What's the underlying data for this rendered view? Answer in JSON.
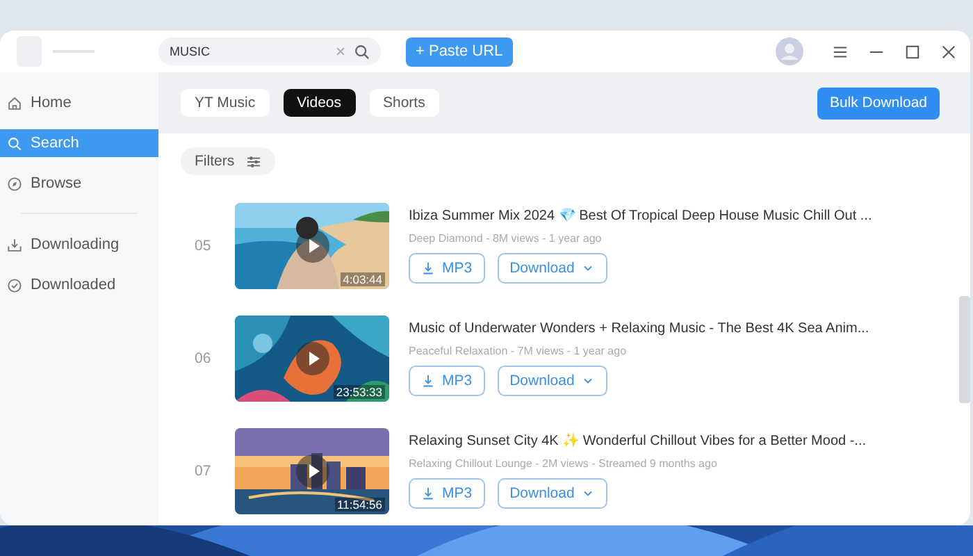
{
  "titlebar": {
    "search": {
      "value": "MUSIC"
    },
    "paste_button": "+ Paste URL"
  },
  "sidebar": {
    "groups": [
      {
        "items": [
          {
            "label": "Home",
            "selected": false
          },
          {
            "label": "Search",
            "selected": true
          },
          {
            "label": "Browse",
            "selected": false
          }
        ]
      },
      {
        "items": [
          {
            "label": "Downloading",
            "selected": false
          },
          {
            "label": "Downloaded",
            "selected": false
          }
        ]
      }
    ]
  },
  "tabs": [
    {
      "label": "YT Music",
      "selected": false
    },
    {
      "label": "Videos",
      "selected": true
    },
    {
      "label": "Shorts",
      "selected": false
    }
  ],
  "bulk_button": "Bulk Download",
  "filters": "Filters",
  "results": [
    {
      "index": "05",
      "title": "Ibiza Summer Mix 2024 💎 Best Of Tropical Deep House Music Chill Out ...",
      "meta": "Deep Diamond - 8M views - 1 year ago",
      "duration": "4:03:44",
      "mp3": "MP3",
      "download": "Download"
    },
    {
      "index": "06",
      "title": "Music of Underwater Wonders + Relaxing Music - The Best 4K Sea Anim...",
      "meta": "Peaceful Relaxation - 7M views - 1 year ago",
      "duration": "23:53:33",
      "mp3": "MP3",
      "download": "Download"
    },
    {
      "index": "07",
      "title": "Relaxing Sunset City 4K ✨ Wonderful Chillout Vibes for a Better Mood -...",
      "meta": "Relaxing Chillout Lounge - 2M views - Streamed 9 months ago",
      "duration": "11:54:56",
      "mp3": "MP3",
      "download": "Download"
    }
  ]
}
